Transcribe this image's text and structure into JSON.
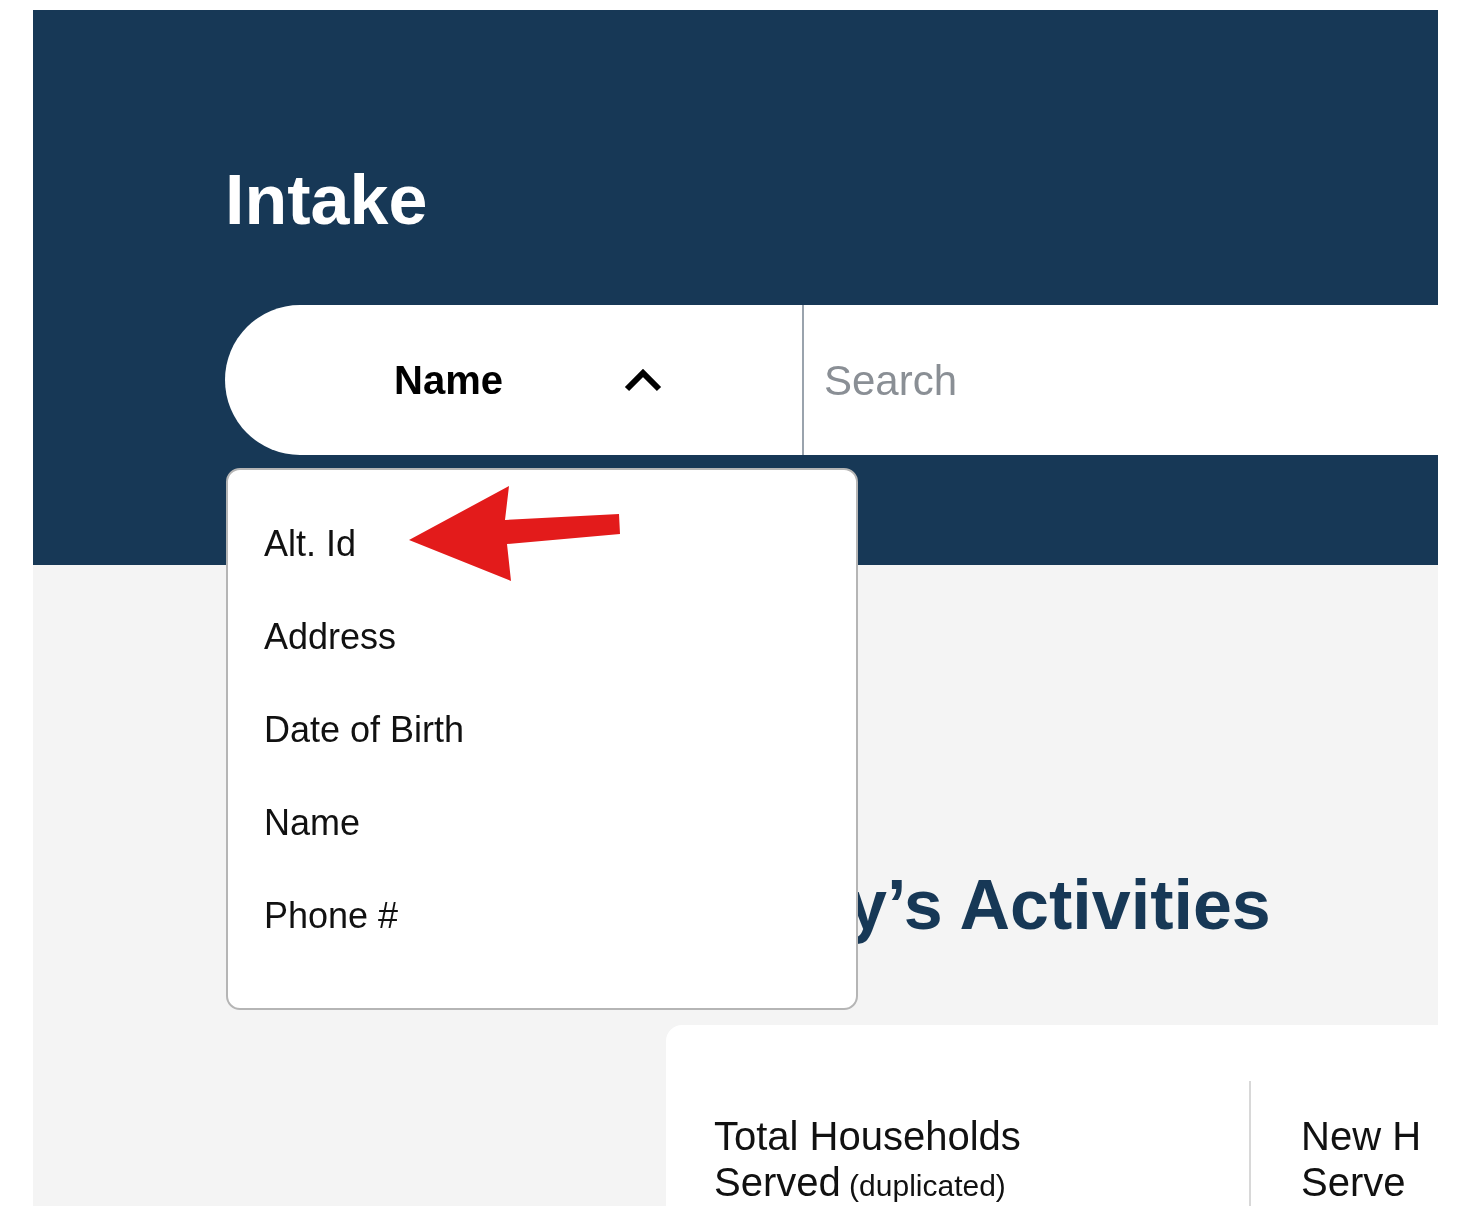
{
  "header": {
    "title": "Intake"
  },
  "search": {
    "field_selector": {
      "value": "Name",
      "expanded": true
    },
    "placeholder": "Search"
  },
  "dropdown": {
    "items": [
      {
        "label": "Alt. Id"
      },
      {
        "label": "Address"
      },
      {
        "label": "Date of Birth"
      },
      {
        "label": "Name"
      },
      {
        "label": "Phone #"
      }
    ]
  },
  "activities": {
    "heading": "y’s Activities",
    "stats": [
      {
        "lines": [
          "Total Households",
          "Served"
        ],
        "note": "(duplicated)"
      },
      {
        "lines": [
          "New H",
          "Serve"
        ]
      }
    ]
  }
}
